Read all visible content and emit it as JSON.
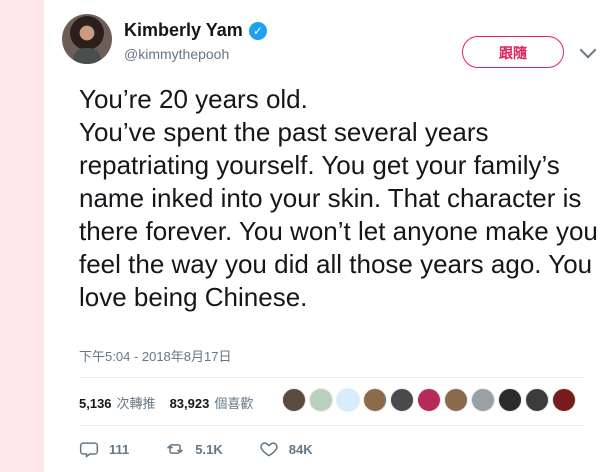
{
  "tweet": {
    "author": {
      "display_name": "Kimberly Yam",
      "handle": "@kimmythepooh",
      "verified_icon": "verified-badge-icon"
    },
    "follow_button_label": "跟隨",
    "text": "You’re 20 years old.\nYou’ve spent the past several years repatriating yourself. You get your family’s name inked into your skin. That character is there forever. You won’t let anyone make you feel the way you did all those years ago. You love being Chinese.",
    "timestamp": "下午5:04 - 2018年8月17日",
    "stats": {
      "retweets": "5,136",
      "retweets_label": "次轉推",
      "likes": "83,923",
      "likes_label": "個喜歡"
    },
    "actions": {
      "replies": "111",
      "retweets": "5.1K",
      "likes": "84K"
    },
    "colors": {
      "accent": "#1da1f2",
      "follow": "#e0245e",
      "muted": "#657786",
      "text": "#14171a",
      "side_bg": "#fde7ea"
    },
    "liker_avatar_colors": [
      "#5b4a3f",
      "#b9cfbf",
      "#d9ecfb",
      "#8d6b4a",
      "#4a4a4a",
      "#b82a56",
      "#8a6a4b",
      "#9aa0a4",
      "#2b2b2b",
      "#3b3b3b",
      "#7a1b1b"
    ]
  }
}
